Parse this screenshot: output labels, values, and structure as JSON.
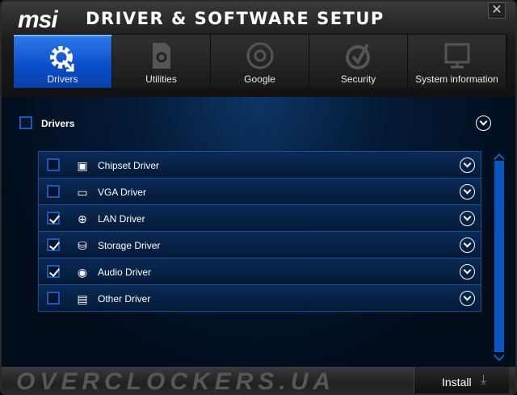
{
  "header": {
    "logo": "msi",
    "title": "DRIVER & SOFTWARE SETUP",
    "close": "✕"
  },
  "tabs": [
    {
      "label": "Drivers",
      "icon": "gear-download-icon",
      "active": true
    },
    {
      "label": "Utilities",
      "icon": "file-gear-icon"
    },
    {
      "label": "Google",
      "icon": "chrome-icon"
    },
    {
      "label": "Security",
      "icon": "shield-check-icon"
    },
    {
      "label": "System information",
      "icon": "monitor-icon"
    }
  ],
  "section": {
    "label": "Drivers",
    "checked": false
  },
  "drivers": [
    {
      "label": "Chipset Driver",
      "checked": false,
      "icon": "chip-icon",
      "glyph": "▣"
    },
    {
      "label": "VGA Driver",
      "checked": false,
      "icon": "graphics-card-icon",
      "glyph": "▭"
    },
    {
      "label": "LAN Driver",
      "checked": true,
      "icon": "globe-network-icon",
      "glyph": "⊕"
    },
    {
      "label": "Storage Driver",
      "checked": true,
      "icon": "storage-icon",
      "glyph": "⛁"
    },
    {
      "label": "Audio Driver",
      "checked": true,
      "icon": "speaker-icon",
      "glyph": "◉"
    },
    {
      "label": "Other Driver",
      "checked": false,
      "icon": "toolbox-icon",
      "glyph": "▤"
    }
  ],
  "footer": {
    "watermark": "OVERCLOCKERS.UA",
    "install": "Install",
    "install_icon": "⤓"
  }
}
